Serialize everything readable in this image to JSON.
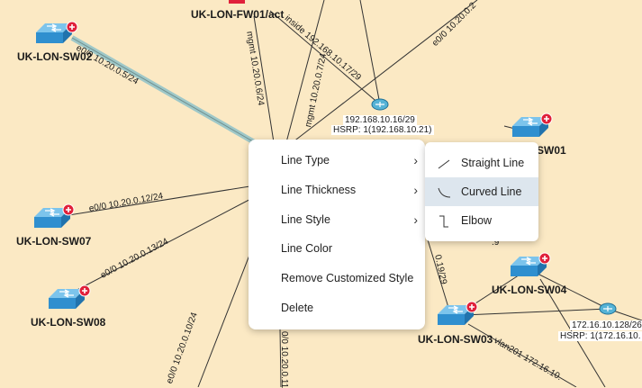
{
  "devices": [
    {
      "name": "UK-LON-SW02"
    },
    {
      "name": "UK-LON-FW01/act"
    },
    {
      "name": "SW01"
    },
    {
      "name": "UK-LON-SW07"
    },
    {
      "name": "UK-LON-SW08"
    },
    {
      "name": "UK-LON-SW04"
    },
    {
      "name": "UK-LON-SW03"
    }
  ],
  "links": {
    "sw02": "e0/0 10.20.0.5/24",
    "mgmt1": "mgmt 10.20.0.6/24",
    "mgmt2": "mgmt 10.20.0.7/24",
    "inside": "inside 192.168.10.17/29",
    "e0_top": "e0/0 10.20.0.2",
    "sw07": "e0/0 10.20.0.12/24",
    "sw08": "e0/0 10.20.0.13/24",
    "bottom1": "e0/0 10.20.0.10/24",
    "bottom2": "0/0 10.20.0.11",
    "sw03a": "0.19/29",
    "sw04a": ".9",
    "vlan201": "vlan201 172.16.10."
  },
  "hsrp1": {
    "line1": "192.168.10.16/29",
    "line2": "HSRP: 1(192.168.10.21)"
  },
  "hsrp2": {
    "line1": "172.16.10.128/26",
    "line2": "HSRP: 1(172.16.10."
  },
  "context_menu": {
    "items": [
      {
        "label": "Line Type",
        "has_submenu": true
      },
      {
        "label": "Line Thickness",
        "has_submenu": true
      },
      {
        "label": "Line Style",
        "has_submenu": true
      },
      {
        "label": "Line Color",
        "has_submenu": false
      },
      {
        "label": "Remove Customized Style",
        "has_submenu": false
      },
      {
        "label": "Delete",
        "has_submenu": false
      }
    ],
    "chevron": "›"
  },
  "submenu": {
    "items": [
      {
        "label": "Straight Line",
        "icon": "straight-line-icon",
        "selected": false
      },
      {
        "label": "Curved Line",
        "icon": "curved-line-icon",
        "selected": true
      },
      {
        "label": "Elbow",
        "icon": "elbow-line-icon",
        "selected": false
      }
    ]
  },
  "colors": {
    "background": "#fbe9c4",
    "switch_blue": "#3c9fd8",
    "badge_red": "#e0203a",
    "highlight_link": "#9fc8c8",
    "selected_item": "#dde6ee"
  }
}
